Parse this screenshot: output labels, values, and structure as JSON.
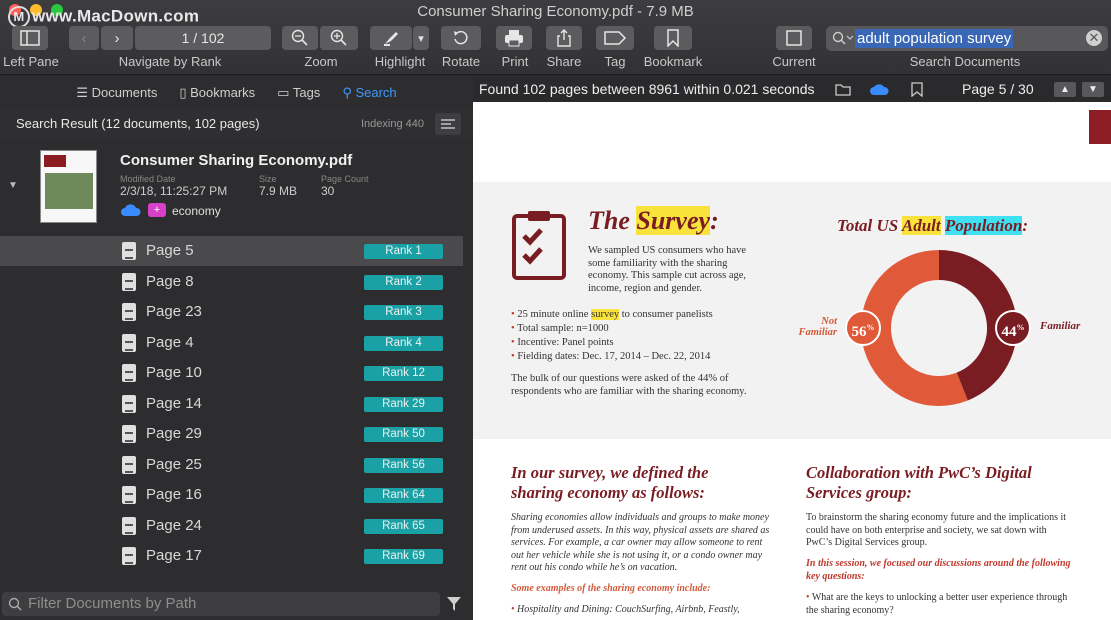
{
  "window": {
    "title": "Consumer Sharing Economy.pdf - 7.9 MB",
    "watermark": "www.MacDown.com"
  },
  "toolbar": {
    "left_pane": "Left Pane",
    "navigate": "Navigate by Rank",
    "page_field": "1 / 102",
    "zoom": "Zoom",
    "highlight": "Highlight",
    "rotate": "Rotate",
    "print": "Print",
    "share": "Share",
    "tag": "Tag",
    "bookmark": "Bookmark",
    "current": "Current",
    "search_documents": "Search Documents",
    "search_value": "adult population survey"
  },
  "tabs": {
    "documents": "Documents",
    "bookmarks": "Bookmarks",
    "tags": "Tags",
    "search": "Search"
  },
  "results": {
    "header": "Search Result (12 documents, 102 pages)",
    "indexing": "Indexing 440"
  },
  "document": {
    "name": "Consumer Sharing Economy.pdf",
    "modified_label": "Modified Date",
    "modified": "2/3/18, 11:25:27 PM",
    "size_label": "Size",
    "size": "7.9 MB",
    "count_label": "Page Count",
    "count": "30",
    "tag": "economy"
  },
  "pages": [
    {
      "page": "Page 5",
      "rank": "Rank 1"
    },
    {
      "page": "Page 8",
      "rank": "Rank 2"
    },
    {
      "page": "Page 23",
      "rank": "Rank 3"
    },
    {
      "page": "Page 4",
      "rank": "Rank 4"
    },
    {
      "page": "Page 10",
      "rank": "Rank 12"
    },
    {
      "page": "Page 14",
      "rank": "Rank 29"
    },
    {
      "page": "Page 29",
      "rank": "Rank 50"
    },
    {
      "page": "Page 25",
      "rank": "Rank 56"
    },
    {
      "page": "Page 16",
      "rank": "Rank 64"
    },
    {
      "page": "Page 24",
      "rank": "Rank 65"
    },
    {
      "page": "Page 17",
      "rank": "Rank 69"
    }
  ],
  "filter": {
    "placeholder": "Filter Documents by Path"
  },
  "findbar": {
    "found": "Found 102 pages between 8961 within 0.021 seconds",
    "page": "Page 5 / 30"
  },
  "pdf": {
    "survey_title_the": "The ",
    "survey_title_hl": "Survey",
    ":": ":",
    "survey_intro": "We sampled US consumers who have some familiarity with the sharing economy. This sample cut across age, income, region and gender.",
    "bullets": [
      "25 minute online ",
      "survey",
      " to consumer panelists",
      "Total sample: n=1000",
      "Incentive: Panel points",
      "Fielding dates: Dec. 17, 2014 – Dec. 22, 2014"
    ],
    "bulk": "The bulk of our questions were asked of the 44% of respondents who are familiar with the sharing economy.",
    "pop_title_1": "Total US ",
    "pop_title_adult": "Adult",
    "pop_title_population": "Population",
    "not_familiar_1": "Not",
    "not_familiar_2": "Familiar",
    "familiar": "Familiar",
    "pct_not": "56",
    "pct_fam": "44",
    "pct_sign": "%",
    "h_defined": "In our survey, we defined the sharing economy as follows:",
    "defined_text": "Sharing economies allow individuals and groups to make money from underused assets. In this way, physical assets are shared as services. For example, a car owner may allow someone to rent out her vehicle while she is not using it, or a condo owner may rent out his condo while he’s on vacation.",
    "examples": "Some examples of the sharing economy include:",
    "example_1": "Hospitality and Dining: CouchSurfing, Airbnb, Feastly,",
    "h_collab": "Collaboration with PwC’s Digital Services  group:",
    "collab_text": "To brainstorm the sharing economy future and the implications it could have on both enterprise and society, we sat down with PwC’s Digital Services group.",
    "session": "In this session, we focused our discussions around the following key questions:",
    "question_1": "What are the keys to unlocking a better user experience through the sharing economy?"
  },
  "chart_data": {
    "type": "pie",
    "categories": [
      "Not Familiar",
      "Familiar"
    ],
    "values": [
      56,
      44
    ],
    "title": "Total US Adult Population:"
  }
}
